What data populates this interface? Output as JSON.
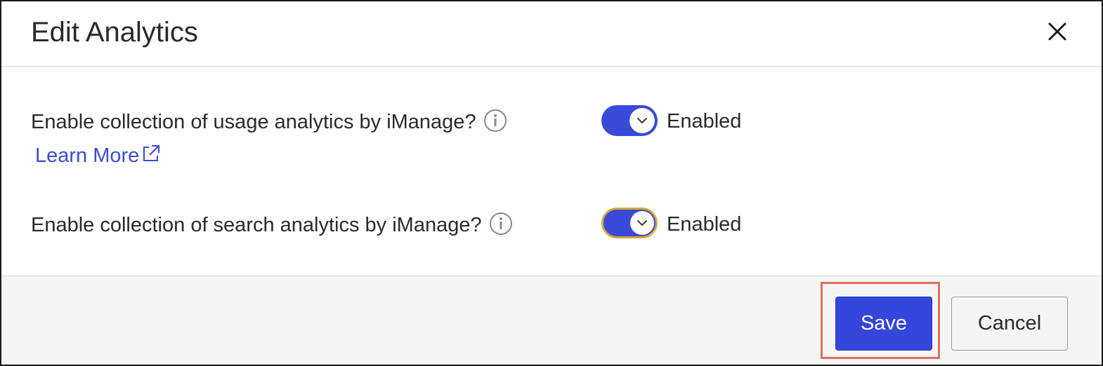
{
  "dialog": {
    "title": "Edit Analytics",
    "close_icon": "close-icon"
  },
  "settings": [
    {
      "question": "Enable collection of usage analytics by iManage?",
      "info_icon": "info-icon",
      "link_text": "Learn More",
      "link_icon": "external-link-icon",
      "toggle_on": true,
      "status": "Enabled"
    },
    {
      "question": "Enable collection of search analytics by iManage?",
      "info_icon": "info-icon",
      "toggle_on": true,
      "status": "Enabled"
    }
  ],
  "footer": {
    "save_label": "Save",
    "cancel_label": "Cancel"
  },
  "colors": {
    "accent": "#3446db",
    "focus_ring": "#d9a73a",
    "highlight": "#e07060",
    "link": "#3b4bd8"
  }
}
